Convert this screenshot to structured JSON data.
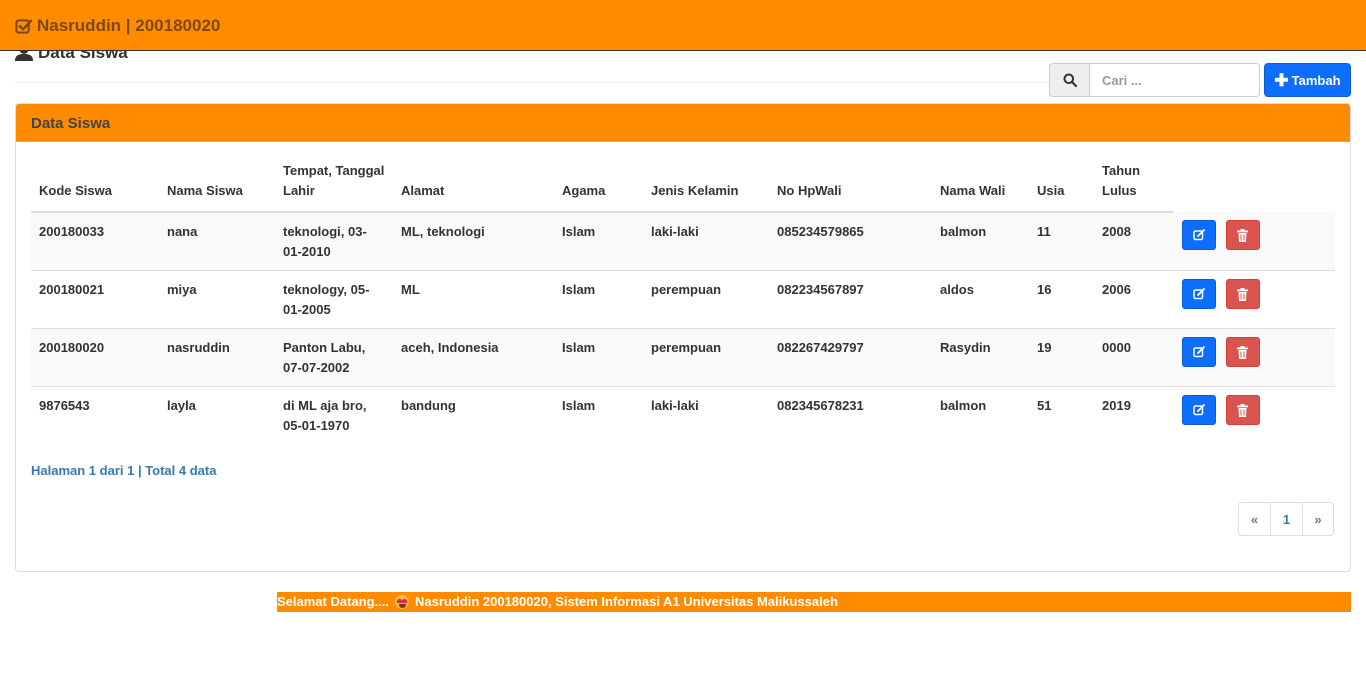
{
  "navbar": {
    "brand": "Nasruddin | 200180020"
  },
  "header": {
    "title": "Data Siswa"
  },
  "search": {
    "placeholder": "Cari ..."
  },
  "toolbar": {
    "add_label": "Tambah"
  },
  "panel": {
    "title": "Data Siswa"
  },
  "table": {
    "headers": {
      "kode": "Kode Siswa",
      "nama": "Nama Siswa",
      "ttl": "Tempat, Tanggal Lahir",
      "alamat": "Alamat",
      "agama": "Agama",
      "jk": "Jenis Kelamin",
      "hp": "No HpWali",
      "wali": "Nama Wali",
      "usia": "Usia",
      "lulus": "Tahun Lulus"
    },
    "rows": [
      {
        "kode": "200180033",
        "nama": "nana",
        "ttl": "teknologi, 03-01-2010",
        "alamat": "ML, teknologi",
        "agama": "Islam",
        "jk": "laki-laki",
        "hp": "085234579865",
        "wali": "balmon",
        "usia": "11",
        "lulus": "2008"
      },
      {
        "kode": "200180021",
        "nama": "miya",
        "ttl": "teknology, 05-01-2005",
        "alamat": "ML",
        "agama": "Islam",
        "jk": "perempuan",
        "hp": "082234567897",
        "wali": "aldos",
        "usia": "16",
        "lulus": "2006"
      },
      {
        "kode": "200180020",
        "nama": "nasruddin",
        "ttl": "Panton Labu, 07-07-2002",
        "alamat": "aceh, Indonesia",
        "agama": "Islam",
        "jk": "perempuan",
        "hp": "082267429797",
        "wali": "Rasydin",
        "usia": "19",
        "lulus": "0000"
      },
      {
        "kode": "9876543",
        "nama": "layla",
        "ttl": "di ML aja bro, 05-01-1970",
        "alamat": "bandung",
        "agama": "Islam",
        "jk": "laki-laki",
        "hp": "082345678231",
        "wali": "balmon",
        "usia": "51",
        "lulus": "2019"
      }
    ]
  },
  "footer": {
    "page_info": "Halaman 1 dari 1 | Total 4 data",
    "pagination": {
      "prev": "«",
      "current": "1",
      "next": "»"
    }
  },
  "marquee": {
    "prefix": "Selamat Datang....",
    "text": "Nasruddin 200180020, Sistem Informasi A1 Universitas Malikussaleh"
  },
  "colors": {
    "accent": "#ff8c00",
    "primary": "#0d6efd",
    "danger": "#d9534f",
    "link": "#337ab7"
  },
  "icons": {
    "brand": "check-square-icon",
    "title": "user-icon",
    "search": "search-icon",
    "add": "plus-icon",
    "edit": "edit-icon",
    "delete": "trash-icon"
  }
}
